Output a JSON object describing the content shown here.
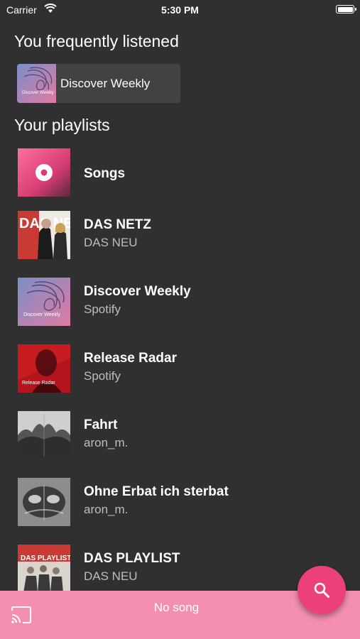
{
  "status_bar": {
    "carrier": "Carrier",
    "time": "5:30 PM"
  },
  "frequent": {
    "heading": "You frequently listened",
    "items": [
      {
        "title": "Discover Weekly",
        "cover_text": "Discover Weekly"
      }
    ]
  },
  "playlists": {
    "heading": "Your playlists",
    "items": [
      {
        "title": "Songs",
        "subtitle": "",
        "cover": "songs-icon"
      },
      {
        "title": "DAS NETZ",
        "subtitle": "DAS NEU",
        "cover_text": "DAS NETZ"
      },
      {
        "title": "Discover Weekly",
        "subtitle": "Spotify",
        "cover_text": "Discover Weekly"
      },
      {
        "title": "Release Radar",
        "subtitle": "Spotify",
        "cover_text": "Release Radar"
      },
      {
        "title": "Fahrt",
        "subtitle": "aron_m."
      },
      {
        "title": "Ohne Erbat ich sterbat",
        "subtitle": "aron_m."
      },
      {
        "title": "DAS PLAYLIST",
        "subtitle": "DAS NEU",
        "cover_text": "DAS PLAYLIST"
      }
    ]
  },
  "player": {
    "now_playing": "No song"
  },
  "colors": {
    "background": "#303030",
    "accent": "#ec407a",
    "player_bar": "#f48fb1",
    "card": "#424242"
  },
  "icons": {
    "search": "search-icon",
    "cast": "cast-icon",
    "wifi": "wifi-icon",
    "battery": "battery-icon"
  }
}
